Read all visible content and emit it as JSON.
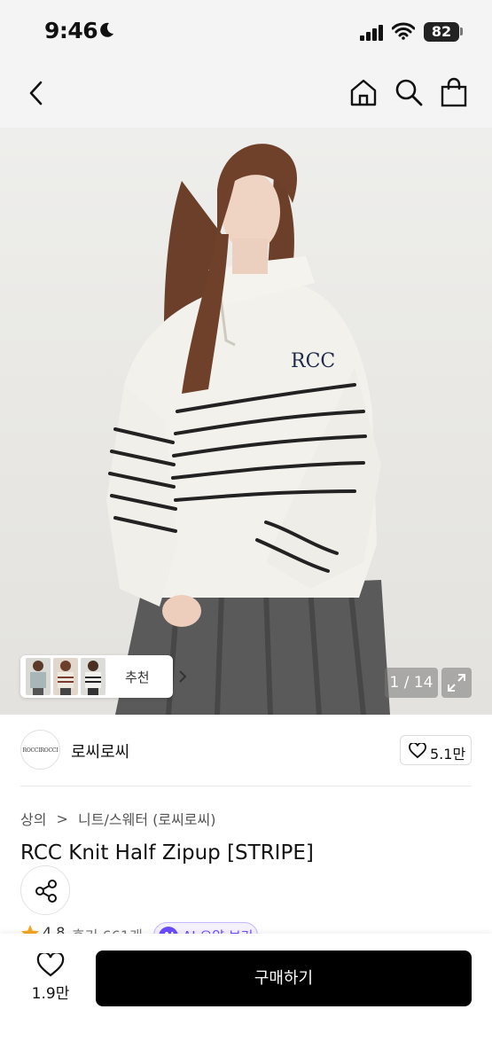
{
  "status_bar": {
    "time": "9:46",
    "battery": "82",
    "icons": [
      "moon-icon",
      "signal-icon",
      "wifi-icon",
      "battery-icon"
    ]
  },
  "nav": {
    "icons": [
      "back-arrow-icon",
      "home-icon",
      "search-icon",
      "shopping-bag-icon"
    ]
  },
  "gallery": {
    "recommend_label": "추천",
    "counter": "1 / 14",
    "expand_icon": "expand-icon"
  },
  "brand": {
    "logo_text": "ROCCIROCCI",
    "name": "로씨로씨",
    "like_count": "5.1만"
  },
  "category": {
    "level1": "상의",
    "separator": ">",
    "level2": "니트/스웨터 (로씨로씨)"
  },
  "product": {
    "title": "RCC Knit Half Zipup [STRIPE]"
  },
  "rating": {
    "score": "4.8",
    "reviews": "후기 661개",
    "ai_badge": "AI",
    "ai_summary": "AI 요약 보기"
  },
  "bottom_bar": {
    "wish_count": "1.9만",
    "buy_label": "구매하기"
  },
  "colors": {
    "accent": "#6b4cff",
    "buy_button": "#000000",
    "star": "#f5a623"
  }
}
